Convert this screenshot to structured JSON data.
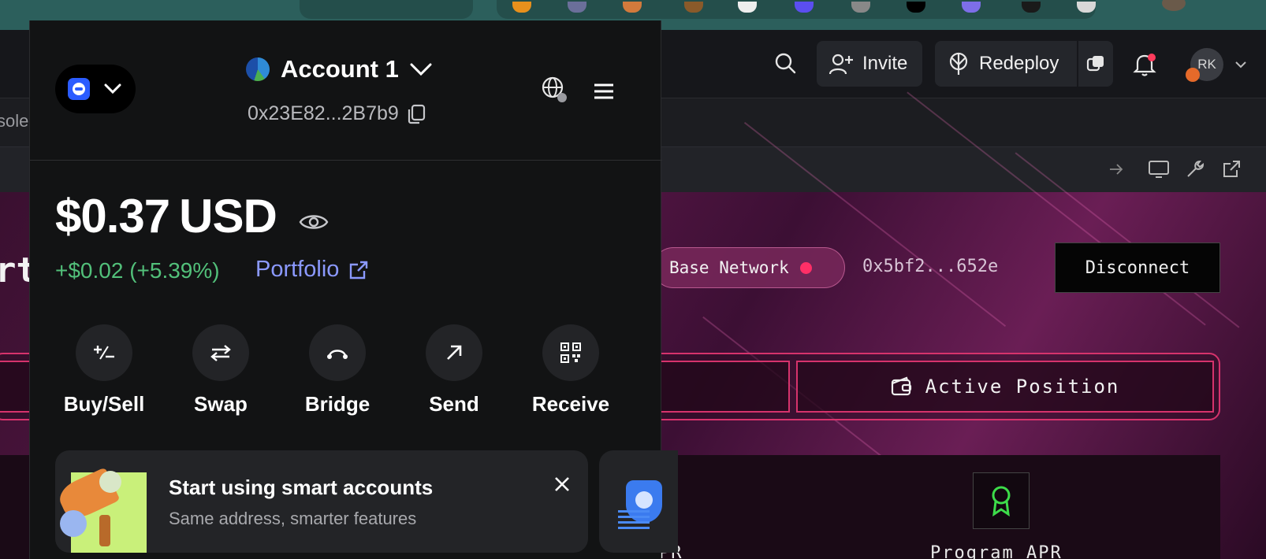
{
  "wallet": {
    "account_name": "Account 1",
    "address": "0x23E82...2B7b9",
    "balance_amount": "$0.37",
    "balance_currency": "USD",
    "change": "+$0.02 (+5.39%)",
    "portfolio_label": "Portfolio",
    "actions": [
      {
        "label": "Buy/Sell",
        "icon": "plus-minus-icon"
      },
      {
        "label": "Swap",
        "icon": "swap-arrows-icon"
      },
      {
        "label": "Bridge",
        "icon": "bridge-icon"
      },
      {
        "label": "Send",
        "icon": "arrow-up-right-icon"
      },
      {
        "label": "Receive",
        "icon": "qr-code-icon"
      }
    ],
    "promo": {
      "title": "Start using smart accounts",
      "subtitle": "Same address, smarter features"
    }
  },
  "app_header": {
    "invite_label": "Invite",
    "redeploy_label": "Redeploy",
    "avatar_initials": "RK",
    "subbar_text": "sole"
  },
  "dapp": {
    "title_fragment": "rt",
    "network_label": "Base Network",
    "wallet_address": "0x5bf2...652e",
    "disconnect_label": "Disconnect",
    "active_tab_label": "Active Position",
    "stat_labels": [
      "PR",
      "Program APR"
    ]
  },
  "colors": {
    "accent_pink": "#d6336c",
    "positive_green": "#52c07a",
    "link_purple": "#8b99ff",
    "network_dot": "#ff2f67"
  }
}
